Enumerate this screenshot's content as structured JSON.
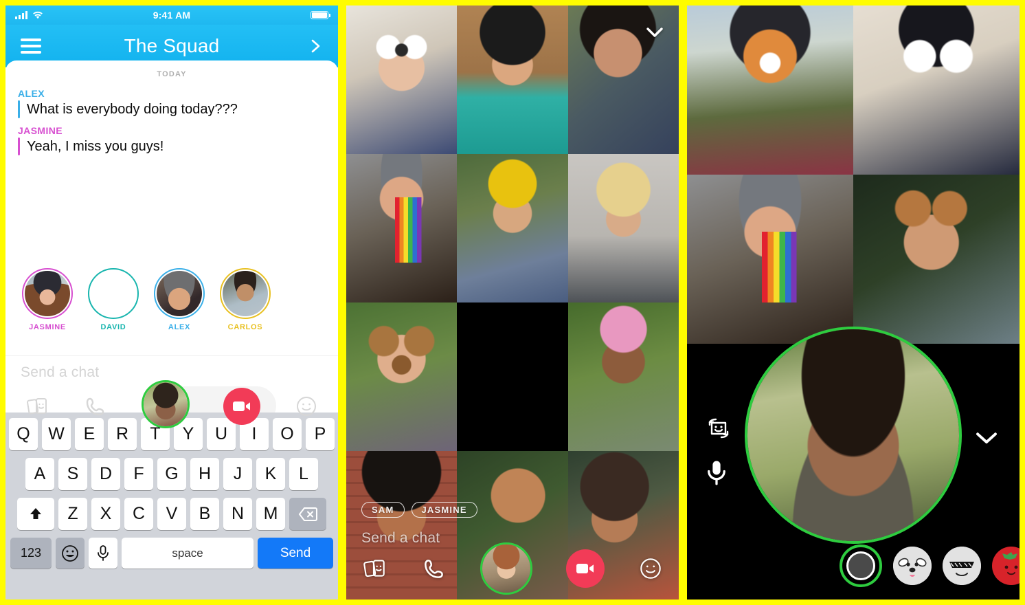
{
  "theme": {
    "brand_yellow": "#FFFC00",
    "chat_blue": "#1FB8F0",
    "send_blue": "#1379F8",
    "record_red": "#F23B57",
    "active_green": "#2ECC3F"
  },
  "chat_panel": {
    "status_bar": {
      "time": "9:41 AM",
      "signal_icon": "signal-bars-icon",
      "wifi_icon": "wifi-icon",
      "battery_icon": "battery-icon"
    },
    "nav": {
      "menu_icon": "hamburger-menu-icon",
      "title": "The Squad",
      "forward_icon": "chevron-right-icon"
    },
    "conversation": {
      "date_divider": "TODAY",
      "messages": [
        {
          "sender": "ALEX",
          "text": "What is everybody doing today???",
          "color": "#3AAFE8"
        },
        {
          "sender": "JASMINE",
          "text": "Yeah, I miss you guys!",
          "color": "#D74FD0"
        }
      ]
    },
    "participants": [
      {
        "name": "JASMINE",
        "color": "#D74FD0"
      },
      {
        "name": "DAVID",
        "color": "#18B5AE"
      },
      {
        "name": "ALEX",
        "color": "#3AAFE8"
      },
      {
        "name": "CARLOS",
        "color": "#E8C020"
      }
    ],
    "input": {
      "placeholder": "Send a chat",
      "icons": [
        "snap-cards-icon",
        "phone-call-icon",
        "self-video-thumbnail",
        "video-call-icon",
        "sticker-smiley-icon"
      ]
    },
    "keyboard": {
      "row1": [
        "Q",
        "W",
        "E",
        "R",
        "T",
        "Y",
        "U",
        "I",
        "O",
        "P"
      ],
      "row2": [
        "A",
        "S",
        "D",
        "F",
        "G",
        "H",
        "J",
        "K",
        "L"
      ],
      "row3_shift": "shift-arrow-icon",
      "row3": [
        "Z",
        "X",
        "C",
        "V",
        "B",
        "N",
        "M"
      ],
      "row3_delete": "backspace-icon",
      "numbers_key": "123",
      "emoji_key": "emoji-smiley-icon",
      "dictation_key": "microphone-icon",
      "space_key": "space",
      "send_key": "Send"
    }
  },
  "grid_panel": {
    "collapse_icon": "chevron-down-icon",
    "tiles": [
      {
        "row": 1,
        "col": 1,
        "lens": "pigtails-glasses-lens"
      },
      {
        "row": 1,
        "col": 2,
        "lens": "none"
      },
      {
        "row": 1,
        "col": 3,
        "lens": "none"
      },
      {
        "row": 2,
        "col": 1,
        "lens": "rainbow-vomit-lens"
      },
      {
        "row": 2,
        "col": 2,
        "lens": "flower-crown-lens"
      },
      {
        "row": 2,
        "col": 3,
        "lens": "none"
      },
      {
        "row": 3,
        "col": 1,
        "lens": "dog-ears-lens"
      },
      {
        "row": 3,
        "col": 2,
        "lens": "none"
      },
      {
        "row": 3,
        "col": 3,
        "lens": "bunny-flower-lens"
      },
      {
        "row": 4,
        "col": 1,
        "lens": "none"
      },
      {
        "row": 4,
        "col": 3,
        "lens": "none"
      }
    ],
    "overlay": {
      "name_pills": [
        "SAM",
        "JASMINE"
      ],
      "placeholder": "Send a chat",
      "icons": [
        "snap-cards-icon",
        "phone-call-icon",
        "self-video-thumbnail",
        "video-call-icon",
        "sticker-smiley-icon"
      ]
    }
  },
  "call_panel": {
    "collapse_icon": "chevron-down-icon",
    "chevron_icon": "chevron-down-icon",
    "side_icons": [
      "flip-camera-icon",
      "microphone-icon"
    ],
    "tiles": [
      {
        "row": 1,
        "col": 1,
        "lens": "deer-face-lens"
      },
      {
        "row": 1,
        "col": 2,
        "lens": "googly-glasses-mustache-lens"
      },
      {
        "row": 2,
        "col": 1,
        "lens": "rainbow-vomit-lens"
      },
      {
        "row": 2,
        "col": 2,
        "lens": "bunny-ears-tongue-lens"
      }
    ],
    "active_speaker": "self-video-circle",
    "lens_carousel": [
      {
        "name": "capture-button",
        "type": "capture"
      },
      {
        "name": "dog-lens",
        "type": "face"
      },
      {
        "name": "sunglasses-lens",
        "type": "face"
      },
      {
        "name": "tomato-lens",
        "type": "tomato"
      },
      {
        "name": "partial-lens",
        "type": "face"
      }
    ]
  }
}
